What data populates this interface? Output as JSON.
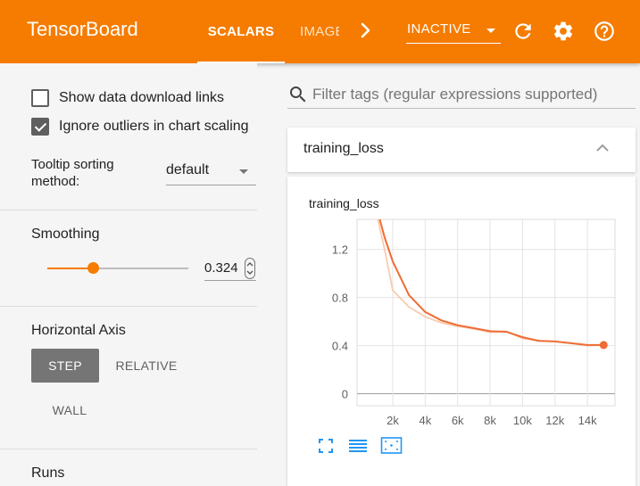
{
  "header": {
    "brand": "TensorBoard",
    "tabs": [
      {
        "label": "SCALARS",
        "active": true
      },
      {
        "label": "IMAGES",
        "active": false
      }
    ],
    "status": "INACTIVE",
    "accent_color": "#f57c00",
    "icons": [
      "chevron-right-icon",
      "refresh-icon",
      "gear-icon",
      "help-icon"
    ]
  },
  "sidebar": {
    "show_download_links": {
      "label": "Show data download links",
      "checked": false
    },
    "ignore_outliers": {
      "label": "Ignore outliers in chart scaling",
      "checked": true
    },
    "tooltip_sorting": {
      "label": "Tooltip sorting method:",
      "value": "default"
    },
    "smoothing": {
      "title": "Smoothing",
      "value": "0.324",
      "fraction": 0.324
    },
    "horizontal_axis": {
      "title": "Horizontal Axis",
      "options": [
        "STEP",
        "RELATIVE",
        "WALL"
      ],
      "selected": "STEP"
    },
    "runs": {
      "title": "Runs"
    }
  },
  "main": {
    "search": {
      "placeholder": "Filter tags (regular expressions supported)"
    },
    "category": {
      "title": "training_loss"
    },
    "card_title": "training_loss",
    "toolbar_icons": [
      "fit-screen-icon",
      "data-list-icon",
      "fit-domain-icon"
    ]
  },
  "chart_data": {
    "type": "line",
    "title": "training_loss",
    "xlabel": "",
    "ylabel": "",
    "x_ticks": [
      2000,
      4000,
      6000,
      8000,
      10000,
      12000,
      14000
    ],
    "x_tick_labels": [
      "2k",
      "4k",
      "6k",
      "8k",
      "10k",
      "12k",
      "14k"
    ],
    "y_ticks": [
      0,
      0.4,
      0.8,
      1.2
    ],
    "y_tick_labels": [
      "0",
      "0.4",
      "0.8",
      "1.2"
    ],
    "xlim": [
      -200,
      15700
    ],
    "ylim": [
      -0.1,
      1.45
    ],
    "grid": true,
    "series": [
      {
        "role": "smoothed",
        "color": "#ef6c34",
        "x": [
          1000,
          1500,
          2000,
          3000,
          4000,
          5000,
          6000,
          7000,
          8000,
          9000,
          10000,
          11000,
          12000,
          13000,
          14000,
          15000
        ],
        "y": [
          1.55,
          1.3,
          1.1,
          0.82,
          0.68,
          0.61,
          0.57,
          0.545,
          0.52,
          0.515,
          0.47,
          0.44,
          0.435,
          0.42,
          0.405,
          0.405
        ]
      },
      {
        "role": "raw",
        "color": "#f9cbb0",
        "x": [
          1000,
          1500,
          2000,
          3000,
          4000,
          5000,
          6000,
          7000,
          8000,
          9000,
          10000,
          11000,
          12000,
          13000,
          14000,
          15000
        ],
        "y": [
          1.5,
          1.2,
          0.86,
          0.72,
          0.64,
          0.59,
          0.56,
          0.54,
          0.51,
          0.52,
          0.46,
          0.44,
          0.435,
          0.42,
          0.4,
          0.405
        ]
      }
    ]
  }
}
